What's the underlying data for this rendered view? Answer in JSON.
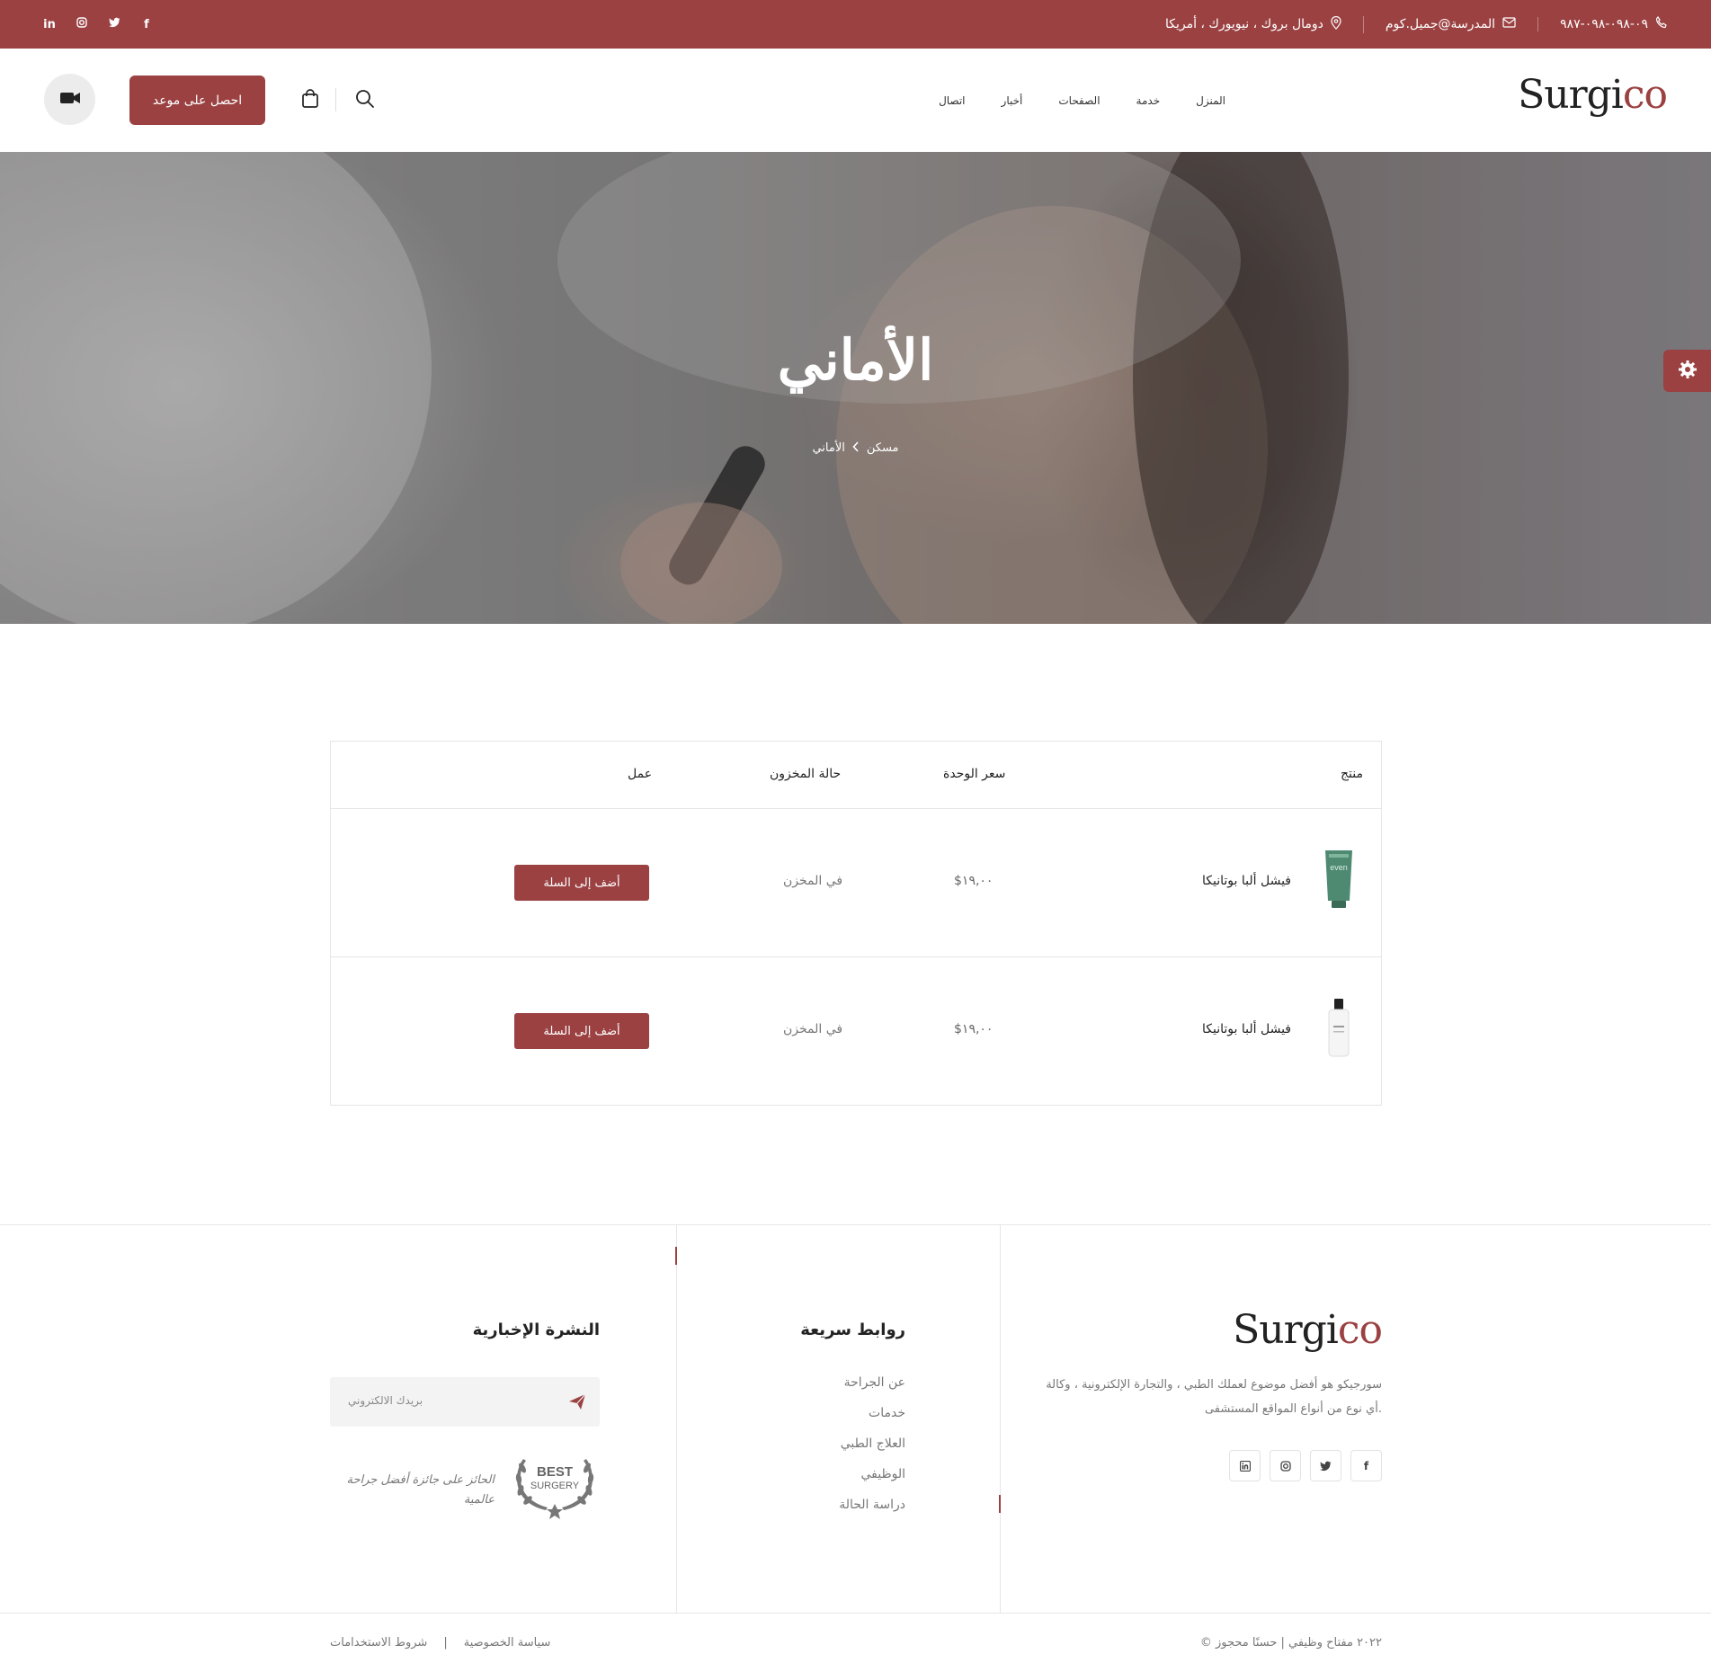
{
  "colors": {
    "accent": "#9b4142",
    "border": "#e6e6e6"
  },
  "topbar": {
    "phone": "٠٩-٠٩٨-٠٩٨-٩٨٧",
    "email": "المدرسة@جميل.كوم",
    "address": "دومال بروك ، نيويورك ، أمريكا",
    "socials": [
      "facebook-icon",
      "twitter-icon",
      "instagram-icon",
      "linkedin-icon"
    ]
  },
  "header": {
    "logo_main": "Surgi",
    "logo_accent": "co",
    "nav": [
      "المنزل",
      "خدمة",
      "الصفحات",
      "أخبار",
      "اتصال"
    ],
    "appointment_label": "احصل على موعد"
  },
  "hero": {
    "title": "الأماني",
    "breadcrumb": [
      "مسكن",
      "الأماني"
    ]
  },
  "wishlist": {
    "headers": {
      "product": "منتج",
      "unit_price": "سعر الوحدة",
      "stock_status": "حالة المخزون",
      "action": "عمل"
    },
    "rows": [
      {
        "name": "فيشل ألبا بوتانيكا",
        "price": "$١٩,٠٠",
        "stock": "في المخزن",
        "button": "أضف إلى السلة"
      },
      {
        "name": "فيشل ألبا بوتانيكا",
        "price": "$١٩,٠٠",
        "stock": "في المخزن",
        "button": "أضف إلى السلة"
      }
    ]
  },
  "footer": {
    "logo_main": "Surgi",
    "logo_accent": "co",
    "description": "سورجيكو هو أفضل موضوع لعملك الطبي ، والتجارة الإلكترونية ، وكالة أي نوع من أنواع المواقع المستشفى.",
    "quick_links_title": "روابط سريعة",
    "quick_links": [
      "عن الجراحة",
      "خدمات",
      "العلاج الطبي",
      "الوظيفي",
      "دراسة الحالة"
    ],
    "newsletter_title": "النشرة الإخبارية",
    "email_placeholder": "بريدك الالكتروني",
    "award_text": "الحائز على جائزة أفضل جراحة عالمية",
    "award_badge_top": "BEST",
    "award_badge_bottom": "SURGERY"
  },
  "bottom": {
    "copyright": "© ٢٠٢٢ مفتاح وظيفي | حسنًا محجوز",
    "privacy": "سياسة الخصوصية",
    "divider": "|",
    "terms": "شروط الاستخدامات"
  }
}
